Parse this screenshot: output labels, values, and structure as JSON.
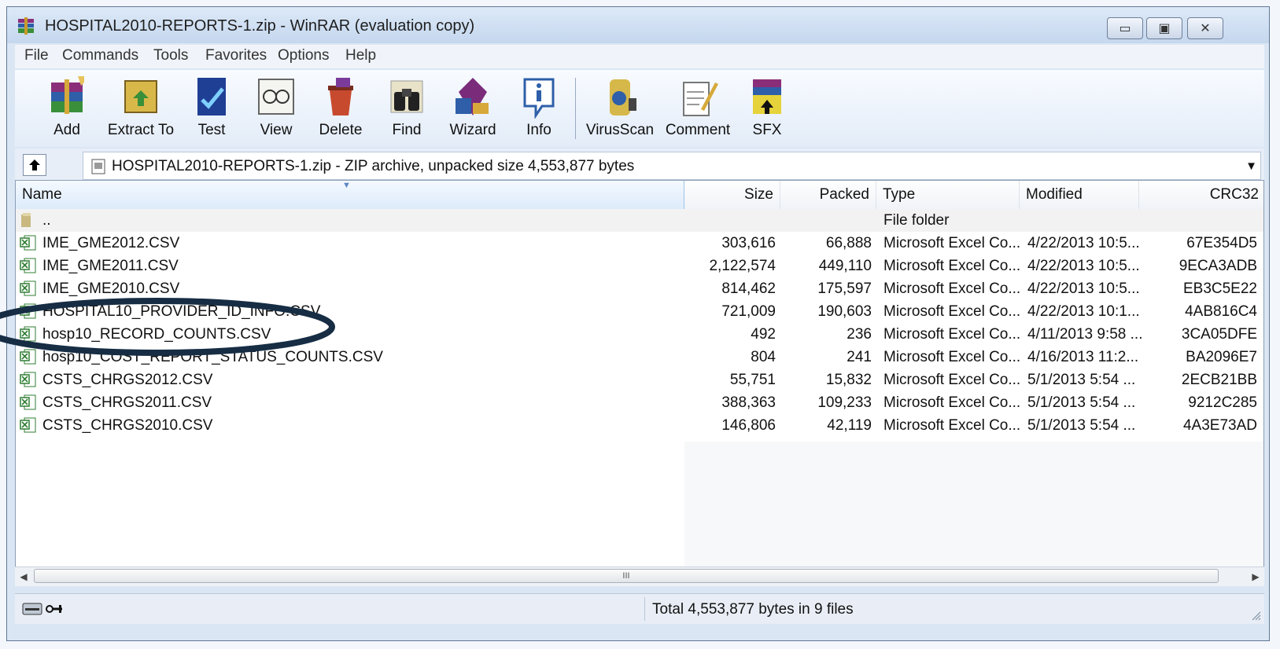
{
  "window": {
    "title": "HOSPITAL2010-REPORTS-1.zip - WinRAR (evaluation copy)",
    "controls": {
      "minimize": "▭",
      "maximize": "▣",
      "close": "✕"
    }
  },
  "menu": [
    "File",
    "Commands",
    "Tools",
    "Favorites",
    "Options",
    "Help"
  ],
  "toolbar": [
    {
      "label": "Add",
      "icon": "add-archive-icon"
    },
    {
      "label": "Extract To",
      "icon": "extract-icon"
    },
    {
      "label": "Test",
      "icon": "test-icon"
    },
    {
      "label": "View",
      "icon": "view-icon"
    },
    {
      "label": "Delete",
      "icon": "delete-icon"
    },
    {
      "label": "Find",
      "icon": "find-binoculars-icon"
    },
    {
      "label": "Wizard",
      "icon": "wizard-icon"
    },
    {
      "label": "Info",
      "icon": "info-icon"
    },
    {
      "label": "VirusScan",
      "icon": "virus-scan-icon"
    },
    {
      "label": "Comment",
      "icon": "comment-icon"
    },
    {
      "label": "SFX",
      "icon": "sfx-icon"
    }
  ],
  "address": {
    "text": "HOSPITAL2010-REPORTS-1.zip - ZIP archive, unpacked size 4,553,877 bytes",
    "dropdown": "▼"
  },
  "columns": {
    "name": "Name",
    "size": "Size",
    "packed": "Packed",
    "type": "Type",
    "modified": "Modified",
    "crc": "CRC32"
  },
  "parent_row": {
    "name": "..",
    "type": "File folder"
  },
  "files": [
    {
      "name": "IME_GME2012.CSV",
      "size": "303,616",
      "packed": "66,888",
      "type": "Microsoft Excel Co...",
      "modified": "4/22/2013 10:5...",
      "crc": "67E354D5"
    },
    {
      "name": "IME_GME2011.CSV",
      "size": "2,122,574",
      "packed": "449,110",
      "type": "Microsoft Excel Co...",
      "modified": "4/22/2013 10:5...",
      "crc": "9ECA3ADB"
    },
    {
      "name": "IME_GME2010.CSV",
      "size": "814,462",
      "packed": "175,597",
      "type": "Microsoft Excel Co...",
      "modified": "4/22/2013 10:5...",
      "crc": "EB3C5E22"
    },
    {
      "name": "HOSPITAL10_PROVIDER_ID_INFO.CSV",
      "size": "721,009",
      "packed": "190,603",
      "type": "Microsoft Excel Co...",
      "modified": "4/22/2013 10:1...",
      "crc": "4AB816C4"
    },
    {
      "name": "hosp10_RECORD_COUNTS.CSV",
      "size": "492",
      "packed": "236",
      "type": "Microsoft Excel Co...",
      "modified": "4/11/2013 9:58 ...",
      "crc": "3CA05DFE"
    },
    {
      "name": "hosp10_COST_REPORT_STATUS_COUNTS.CSV",
      "size": "804",
      "packed": "241",
      "type": "Microsoft Excel Co...",
      "modified": "4/16/2013 11:2...",
      "crc": "BA2096E7"
    },
    {
      "name": "CSTS_CHRGS2012.CSV",
      "size": "55,751",
      "packed": "15,832",
      "type": "Microsoft Excel Co...",
      "modified": "5/1/2013 5:54 ...",
      "crc": "2ECB21BB"
    },
    {
      "name": "CSTS_CHRGS2011.CSV",
      "size": "388,363",
      "packed": "109,233",
      "type": "Microsoft Excel Co...",
      "modified": "5/1/2013 5:54 ...",
      "crc": "9212C285"
    },
    {
      "name": "CSTS_CHRGS2010.CSV",
      "size": "146,806",
      "packed": "42,119",
      "type": "Microsoft Excel Co...",
      "modified": "5/1/2013 5:54 ...",
      "crc": "4A3E73AD"
    }
  ],
  "scrollbar": {
    "left": "◀",
    "right": "▶",
    "grip": "III"
  },
  "status": {
    "text": "Total 4,553,877 bytes in 9 files"
  },
  "colors": {
    "annotation": "#162d44",
    "accent": "#3a6ea5"
  }
}
